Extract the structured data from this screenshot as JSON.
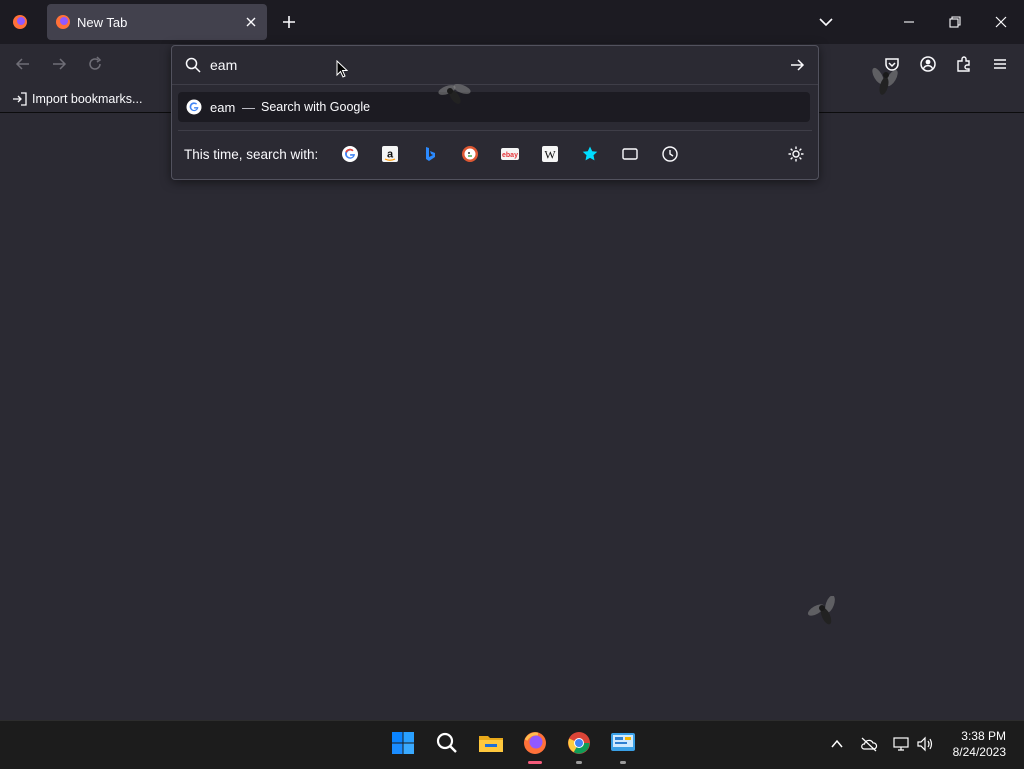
{
  "browser": {
    "tab": {
      "title": "New Tab"
    },
    "bookmarks": {
      "import_label": "Import bookmarks..."
    },
    "urlbar": {
      "input_value": "eam",
      "result": {
        "query": "eam",
        "dash": "—",
        "action": "Search with Google"
      },
      "oneoff_label": "This time, search with:",
      "engines": [
        "Google",
        "Amazon",
        "Bing",
        "DuckDuckGo",
        "eBay",
        "Wikipedia",
        "bookmarks",
        "tabs",
        "history"
      ]
    },
    "icons": {
      "app": "firefox-icon",
      "tab_close": "close-icon",
      "new_tab": "plus-icon",
      "list_tabs": "chevron-down-icon",
      "back": "arrow-left-icon",
      "forward": "arrow-right-icon",
      "reload": "reload-icon",
      "pocket": "pocket-icon",
      "account": "account-icon",
      "extensions": "puzzle-icon",
      "menu": "hamburger-icon",
      "search": "search-icon",
      "go": "arrow-right-icon",
      "settings": "gear-icon"
    }
  },
  "taskbar": {
    "apps": [
      "Start",
      "Search",
      "File Explorer",
      "Firefox",
      "Chrome",
      "Control Panel"
    ],
    "clock": {
      "time": "3:38 PM",
      "date": "8/24/2023"
    }
  },
  "colors": {
    "accent": "#0060df",
    "toolbar": "#2b2a33",
    "frame": "#1c1b22",
    "taskbar": "#1c1c1c"
  }
}
